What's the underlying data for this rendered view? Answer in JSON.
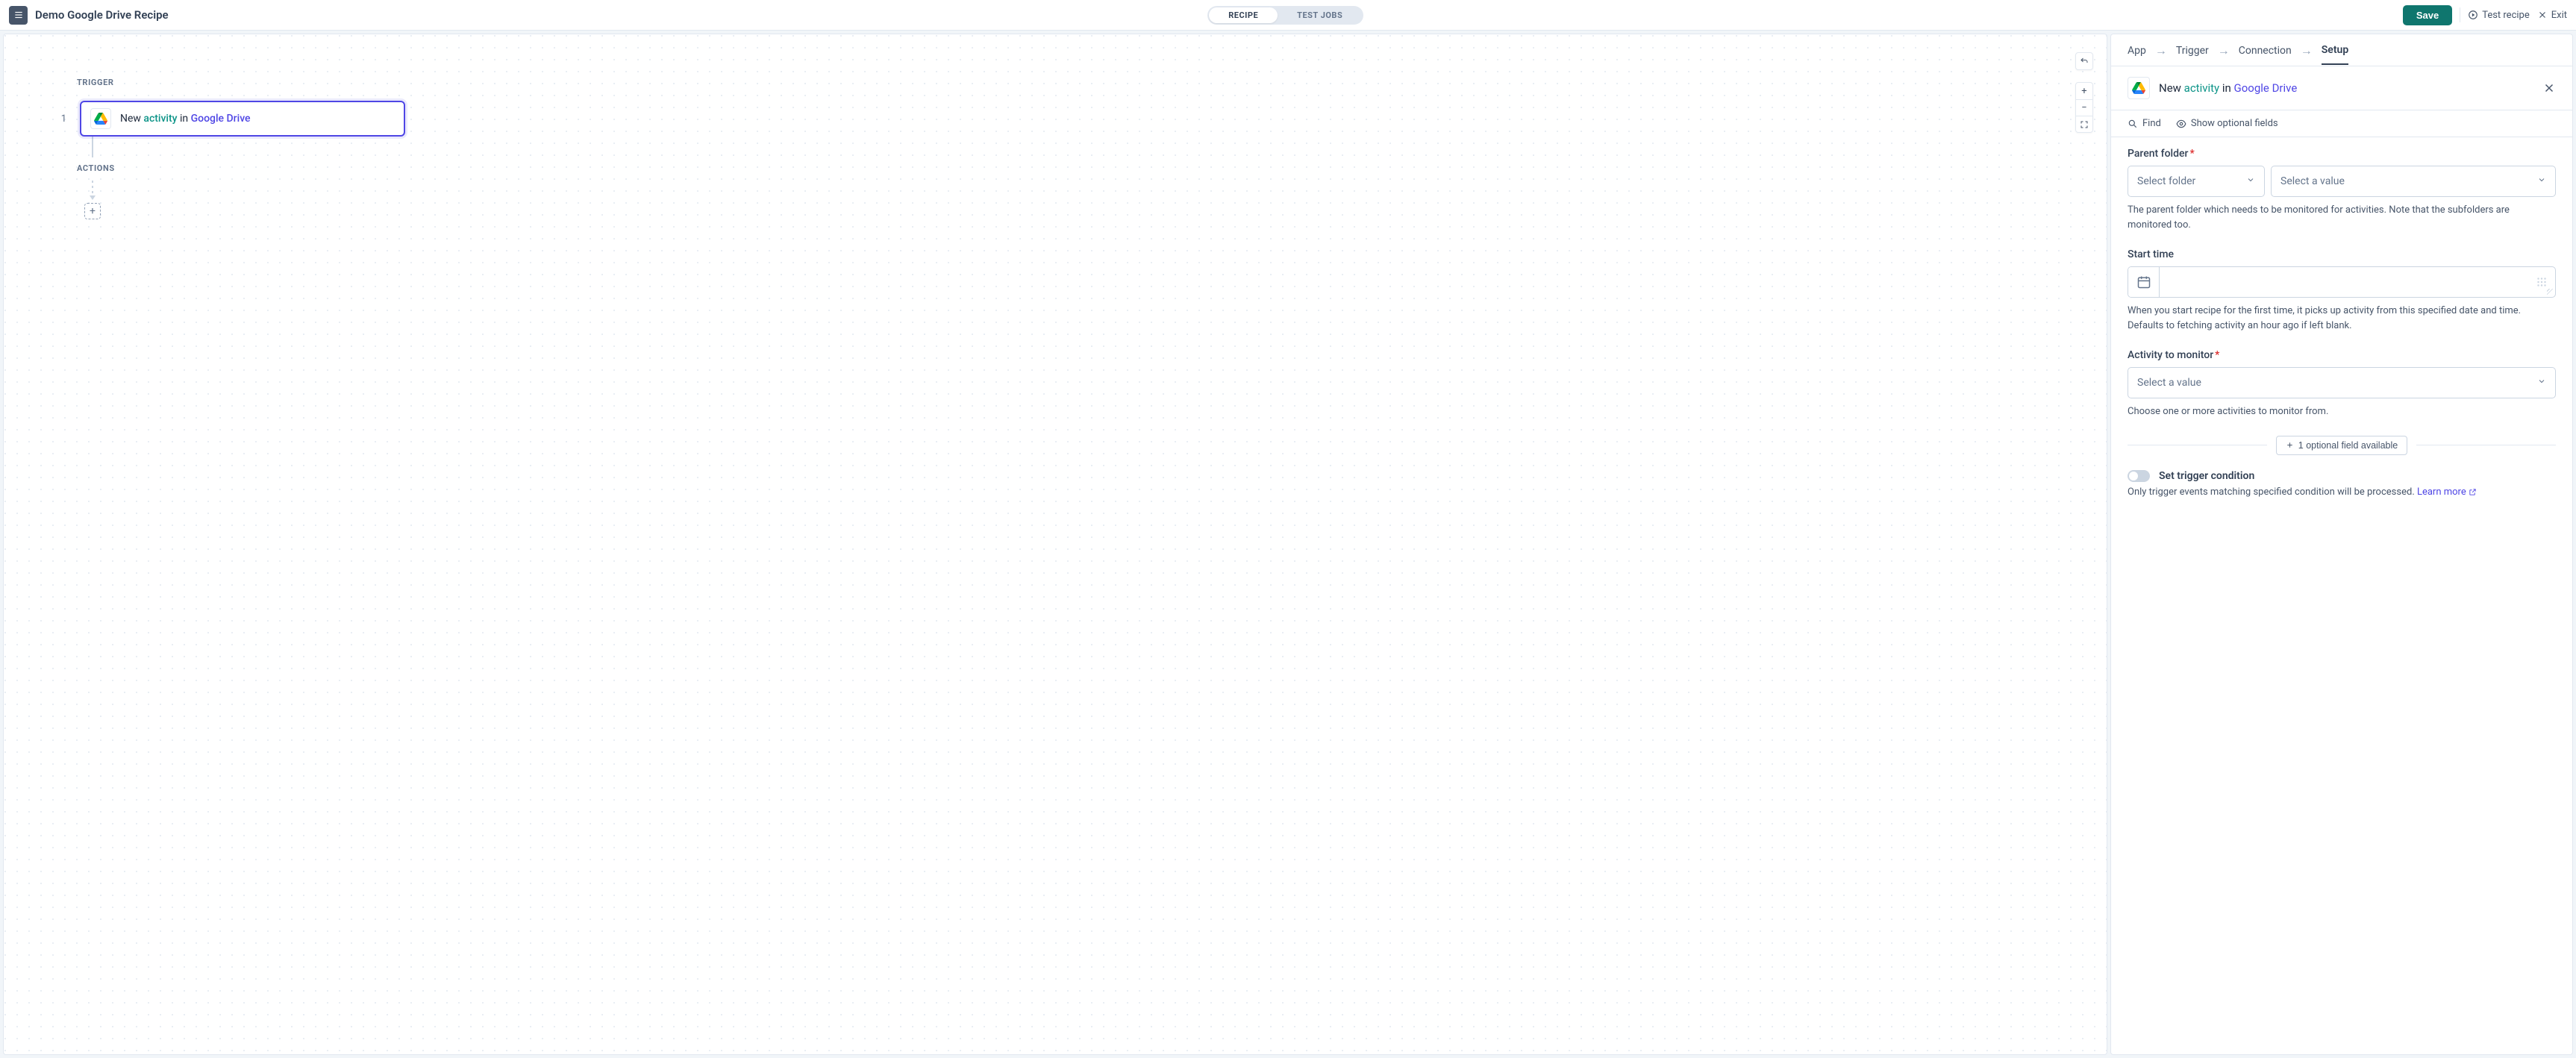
{
  "header": {
    "title": "Demo Google Drive Recipe",
    "mode_recipe": "RECIPE",
    "mode_test_jobs": "TEST JOBS",
    "save": "Save",
    "test_recipe": "Test recipe",
    "exit": "Exit"
  },
  "canvas": {
    "trigger_label": "TRIGGER",
    "step_number": "1",
    "step_prefix": "New ",
    "step_activity": "activity",
    "step_in": " in ",
    "step_app": "Google Drive",
    "actions_label": "ACTIONS"
  },
  "wizard": {
    "app": "App",
    "trigger": "Trigger",
    "connection": "Connection",
    "setup": "Setup"
  },
  "config_header": {
    "prefix": "New ",
    "activity": "activity",
    "in": " in ",
    "app": "Google Drive"
  },
  "toolbar": {
    "find": "Find",
    "show_optional": "Show optional fields"
  },
  "fields": {
    "parent_folder": {
      "label": "Parent folder",
      "select_folder_placeholder": "Select folder",
      "select_value_placeholder": "Select a value",
      "help": "The parent folder which needs to be monitored for activities. Note that the subfolders are monitored too."
    },
    "start_time": {
      "label": "Start time",
      "help": "When you start recipe for the first time, it picks up activity from this specified date and time. Defaults to fetching activity an hour ago if left blank."
    },
    "activity_monitor": {
      "label": "Activity to monitor",
      "placeholder": "Select a value",
      "help": "Choose one or more activities to monitor from."
    },
    "optional_btn": "1 optional field available",
    "trigger_condition": {
      "label": "Set trigger condition",
      "help": "Only trigger events matching specified condition will be processed. ",
      "learn_more": "Learn more"
    }
  }
}
